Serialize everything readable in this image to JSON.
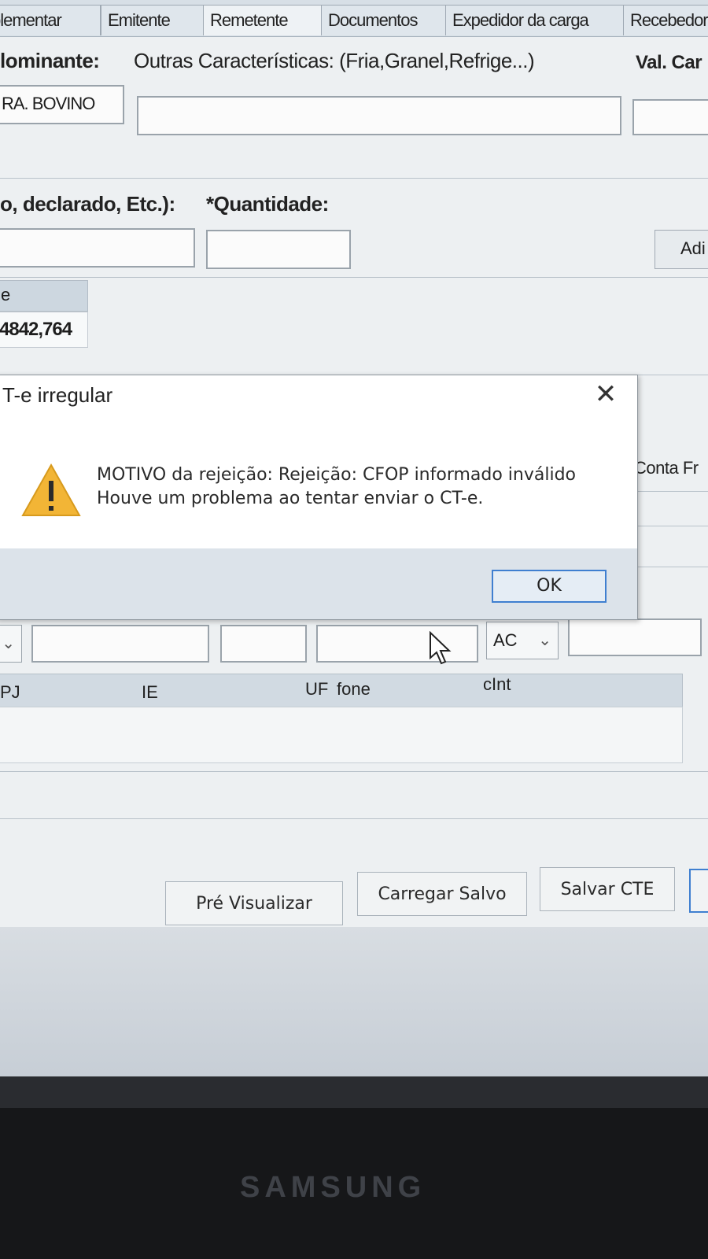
{
  "tabs": [
    "plementar",
    "Emitente",
    "Remetente",
    "Documentos",
    "Expedidor da carga",
    "Recebedor"
  ],
  "cargo": {
    "predominant_label": "lominante:",
    "other_characteristics_label": "Outras Características: (Fria,Granel,Refrige...)",
    "value_label": "Val. Car",
    "predominant_value": "RA. BOVINO"
  },
  "quantity": {
    "type_label": "o, declarado, Etc.):",
    "quantity_label": "*Quantidade:",
    "add_button": "Adi",
    "grid_header": "e",
    "grid_value": "4842,764"
  },
  "dialog": {
    "title": "T-e irregular",
    "close_symbol": "✕",
    "line1": "MOTIVO da rejeição: Rejeição: CFOP informado inválido",
    "line2": "Houve um problema ao tentar enviar o CT-e.",
    "ok_label": "OK",
    "warning_icon": "warning-triangle-icon",
    "warning_color": "#f2b536"
  },
  "side_label": "Conta Fr",
  "address": {
    "state_value": "AC",
    "columns": [
      "PJ",
      "IE",
      "UF",
      "fone",
      "cInt"
    ]
  },
  "buttons": {
    "preview": "Pré Visualizar",
    "load_saved": "Carregar Salvo",
    "save_cte": "Salvar CTE"
  },
  "device": {
    "brand": "SAMSUNG"
  }
}
